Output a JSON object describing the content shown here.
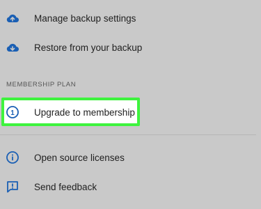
{
  "menu": {
    "manage_backup": {
      "label": "Manage backup settings",
      "icon": "cloud-upload-icon"
    },
    "restore_backup": {
      "label": "Restore from your backup",
      "icon": "cloud-download-icon"
    }
  },
  "membership": {
    "section_title": "MEMBERSHIP PLAN",
    "upgrade": {
      "label": "Upgrade to membership",
      "icon": "numbered-circle-icon",
      "icon_text": "1"
    }
  },
  "about": {
    "licenses": {
      "label": "Open source licenses",
      "icon": "info-icon"
    },
    "feedback": {
      "label": "Send feedback",
      "icon": "feedback-icon"
    }
  },
  "colors": {
    "icon_blue": "#1a5fb4",
    "highlight_green": "#3ef33e",
    "background": "#c9c9c9"
  }
}
